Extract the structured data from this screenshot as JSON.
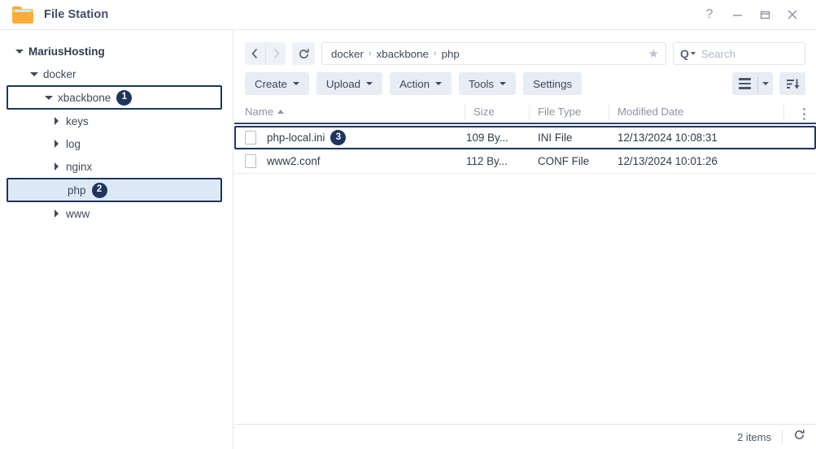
{
  "window": {
    "title": "File Station",
    "app_icon": "folder-icon",
    "controls": [
      {
        "name": "help-button",
        "glyph": "?"
      },
      {
        "name": "minimize-button",
        "glyph": "minimize-icon"
      },
      {
        "name": "maximize-button",
        "glyph": "maximize-icon"
      },
      {
        "name": "close-button",
        "glyph": "close-icon"
      }
    ]
  },
  "sidebar": {
    "items": [
      {
        "label": "MariusHosting",
        "indent": 0,
        "caret": "down",
        "state": "normal",
        "badge": null
      },
      {
        "label": "docker",
        "indent": 1,
        "caret": "down",
        "state": "normal",
        "badge": null
      },
      {
        "label": "xbackbone",
        "indent": 2,
        "caret": "down",
        "state": "boxed",
        "badge": "1"
      },
      {
        "label": "keys",
        "indent": 3,
        "caret": "right",
        "state": "normal",
        "badge": null
      },
      {
        "label": "log",
        "indent": 3,
        "caret": "right",
        "state": "normal",
        "badge": null
      },
      {
        "label": "nginx",
        "indent": 3,
        "caret": "right",
        "state": "normal",
        "badge": null
      },
      {
        "label": "php",
        "indent": 3,
        "caret": "none",
        "state": "selected",
        "badge": "2"
      },
      {
        "label": "www",
        "indent": 3,
        "caret": "right",
        "state": "normal",
        "badge": null
      }
    ]
  },
  "toolbar": {
    "back_label": "‹",
    "forward_label": "›",
    "refresh_label": "refresh-icon",
    "breadcrumb": [
      "docker",
      "xbackbone",
      "php"
    ],
    "breadcrumb_separator": "›",
    "favorite_icon": "star-icon",
    "search": {
      "icon": "search-icon",
      "placeholder": "Search",
      "value": ""
    },
    "buttons": [
      {
        "label": "Create",
        "name": "create-button",
        "caret": true
      },
      {
        "label": "Upload",
        "name": "upload-button",
        "caret": true
      },
      {
        "label": "Action",
        "name": "action-button",
        "caret": true
      },
      {
        "label": "Tools",
        "name": "tools-button",
        "caret": true
      },
      {
        "label": "Settings",
        "name": "settings-button",
        "caret": false
      }
    ],
    "view_icon": "list-view-icon",
    "view_dropdown_icon": "chevron-down-icon",
    "sort_icon": "sort-descending-icon"
  },
  "file_list": {
    "columns": [
      {
        "label": "Name",
        "sorted": "asc"
      },
      {
        "label": "Size",
        "sorted": null
      },
      {
        "label": "File Type",
        "sorted": null
      },
      {
        "label": "Modified Date",
        "sorted": null
      }
    ],
    "column_menu_icon": "kebab-menu-icon",
    "rows": [
      {
        "name": "php-local.ini",
        "size": "109 By...",
        "type": "INI File",
        "modified": "12/13/2024 10:08:31",
        "selected": true,
        "badge": "3",
        "icon": "file-icon"
      },
      {
        "name": "www2.conf",
        "size": "112 By...",
        "type": "CONF File",
        "modified": "12/13/2024 10:01:26",
        "selected": false,
        "badge": null,
        "icon": "file-icon"
      }
    ]
  },
  "statusbar": {
    "item_count": "2 items",
    "refresh_icon": "refresh-icon"
  },
  "colors": {
    "accent_navy": "#1e355e",
    "selection_blue": "#dde8f6",
    "toolbar_button": "#e7ecf5",
    "folder_orange": "#f9ac37",
    "header_rule": "#2f4668"
  }
}
